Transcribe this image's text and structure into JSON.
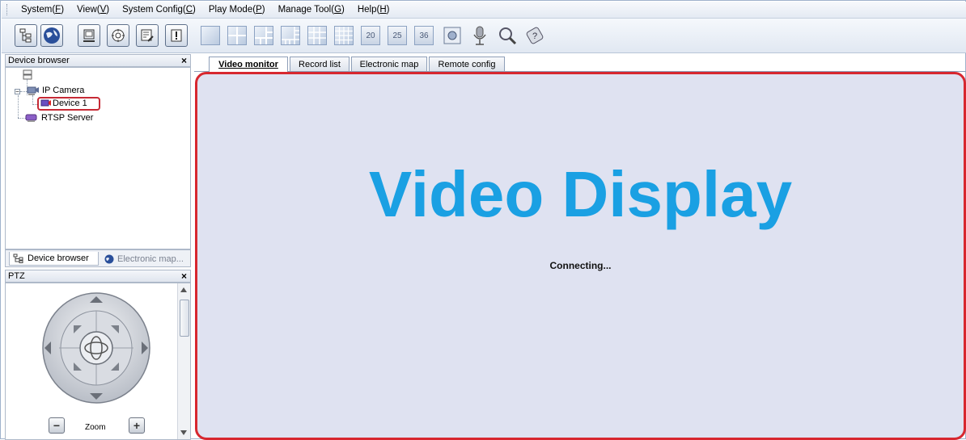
{
  "menu": {
    "items": [
      {
        "label": "System(",
        "key": "F",
        "end": ")"
      },
      {
        "label": "View(",
        "key": "V",
        "end": ")"
      },
      {
        "label": "System Config(",
        "key": "C",
        "end": ")"
      },
      {
        "label": "Play Mode(",
        "key": "P",
        "end": ")"
      },
      {
        "label": "Manage Tool(",
        "key": "G",
        "end": ")"
      },
      {
        "label": "Help(",
        "key": "H",
        "end": ")"
      }
    ]
  },
  "toolbar": {
    "layout_numbers": [
      "20",
      "25",
      "36"
    ],
    "icons": [
      "device-tree-icon",
      "globe-icon",
      "record-icon",
      "ptz-icon",
      "config-icon",
      "alarm-icon",
      "microphone-icon",
      "magnifier-icon",
      "help-icon"
    ]
  },
  "device_browser": {
    "title": "Device browser",
    "close": "×",
    "tree": {
      "root_icon": "server-icon",
      "group": "IP Camera",
      "device": "Device 1",
      "server": "RTSP Server"
    },
    "tabs": {
      "device_browser": "Device browser",
      "electronic_map": "Electronic map..."
    }
  },
  "ptz": {
    "title": "PTZ",
    "close": "×",
    "zoom_label": "Zoom",
    "zoom_minus": "−",
    "zoom_plus": "+"
  },
  "main_tabs": [
    "Video monitor",
    "Record list",
    "Electronic map",
    "Remote config"
  ],
  "display": {
    "title": "Video Display",
    "status": "Connecting..."
  },
  "colors": {
    "title_blue": "#1aa0e3",
    "highlight_red": "#d7272f",
    "display_bg": "#dfe2f1"
  }
}
